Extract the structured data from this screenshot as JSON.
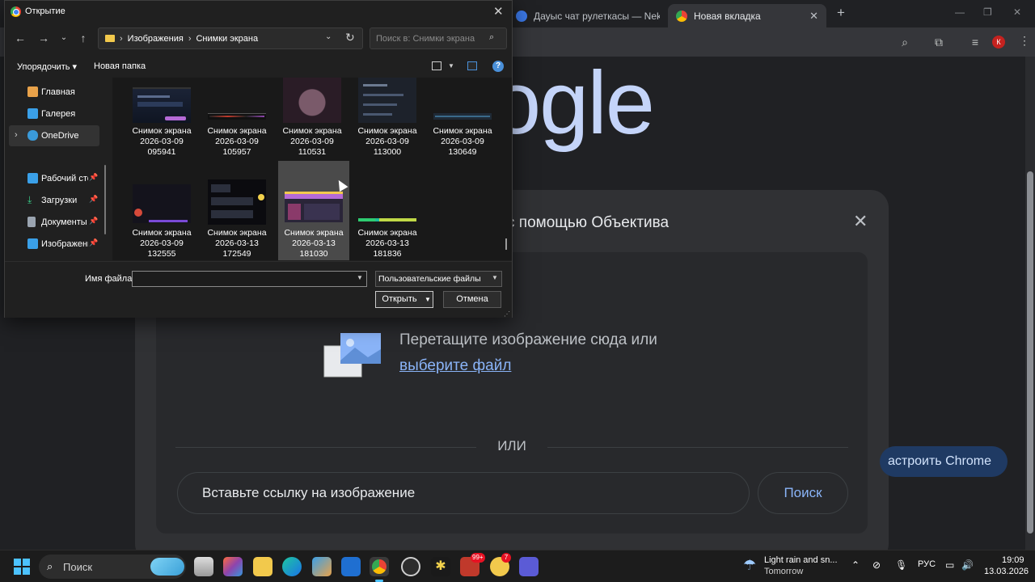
{
  "browser": {
    "tabs": [
      {
        "label": "Дауыс чат рулеткасы — Nekto",
        "active": false
      },
      {
        "label": "Новая вкладка",
        "active": true
      }
    ],
    "new_tab_icon": "plus-icon",
    "window_controls": {
      "minimize": "—",
      "maximize": "❐",
      "close": "✕"
    },
    "profile_initial": "К",
    "accent_color": "#8ab4f8"
  },
  "page": {
    "logo_text": "ogle",
    "lens": {
      "title": "с помощью Объектива",
      "drop_text": "Перетащите изображение сюда или",
      "drop_link": "выберите файл",
      "or_text": "ИЛИ",
      "url_placeholder": "Вставьте ссылку на изображение",
      "search_label": "Поиск"
    },
    "customize_label": "астроить Chrome"
  },
  "dialog": {
    "title": "Открытие",
    "breadcrumbs": [
      "Изображения",
      "Снимки экрана"
    ],
    "search_placeholder": "Поиск в: Снимки экрана",
    "organize_label": "Упорядочить ▾",
    "new_folder_label": "Новая папка",
    "nav_items": [
      {
        "label": "Главная",
        "icon": "home-icon",
        "color": "#e8a24a",
        "pinned": false
      },
      {
        "label": "Галерея",
        "icon": "gallery-icon",
        "color": "#3aa0e8",
        "pinned": false
      },
      {
        "label": "OneDrive",
        "icon": "cloud-icon",
        "color": "#3a9ad9",
        "pinned": false,
        "selected": true
      },
      {
        "label": "Рабочий стол",
        "icon": "desktop-icon",
        "color": "#3aa0e8",
        "pinned": true
      },
      {
        "label": "Загрузки",
        "icon": "download-icon",
        "color": "#3ad08a",
        "pinned": true
      },
      {
        "label": "Документы",
        "icon": "documents-icon",
        "color": "#9aa4b0",
        "pinned": true
      },
      {
        "label": "Изображения",
        "icon": "pictures-icon",
        "color": "#3aa0e8",
        "pinned": true
      }
    ],
    "files": [
      {
        "line1": "Снимок экрана",
        "line2": "2026-03-09",
        "line3": "095941"
      },
      {
        "line1": "Снимок экрана",
        "line2": "2026-03-09",
        "line3": "105957"
      },
      {
        "line1": "Снимок экрана",
        "line2": "2026-03-09",
        "line3": "110531"
      },
      {
        "line1": "Снимок экрана",
        "line2": "2026-03-09",
        "line3": "113000"
      },
      {
        "line1": "Снимок экрана",
        "line2": "2026-03-09",
        "line3": "130649"
      },
      {
        "line1": "Снимок экрана",
        "line2": "2026-03-09",
        "line3": "132555"
      },
      {
        "line1": "Снимок экрана",
        "line2": "2026-03-13",
        "line3": "172549"
      },
      {
        "line1": "Снимок экрана",
        "line2": "2026-03-13",
        "line3": "181030",
        "selected": true
      },
      {
        "line1": "Снимок экрана",
        "line2": "2026-03-13",
        "line3": "181836"
      }
    ],
    "filename_label": "Имя файла:",
    "filename_value": "",
    "filetype_value": "Пользовательские файлы",
    "open_label": "Открыть",
    "cancel_label": "Отмена"
  },
  "taskbar": {
    "search_placeholder": "Поиск",
    "weather_line1": "Light rain and sn...",
    "weather_line2": "Tomorrow",
    "language": "РУС",
    "time": "19:09",
    "date": "13.03.2026",
    "badges": [
      "99+",
      "7"
    ]
  }
}
